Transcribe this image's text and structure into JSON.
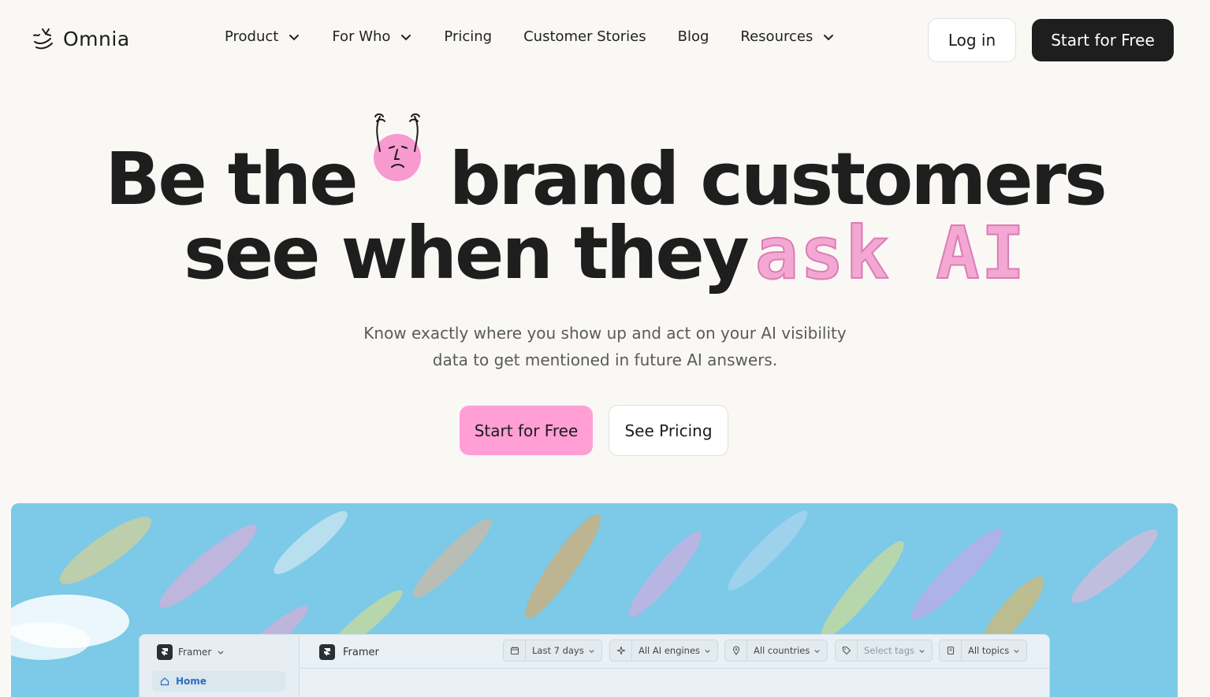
{
  "brand": {
    "name": "Omnia"
  },
  "nav": {
    "items": [
      {
        "label": "Product",
        "dropdown": true
      },
      {
        "label": "For Who",
        "dropdown": true
      },
      {
        "label": "Pricing",
        "dropdown": false
      },
      {
        "label": "Customer Stories",
        "dropdown": false
      },
      {
        "label": "Blog",
        "dropdown": false
      },
      {
        "label": "Resources",
        "dropdown": true
      }
    ],
    "login_label": "Log in",
    "start_label": "Start for Free"
  },
  "hero": {
    "line1_a": "Be the",
    "line1_b": "brand customers",
    "line2_a": "see when they",
    "line2_highlight": "ask AI",
    "subtitle_1": "Know exactly where you show up and act on your AI visibility",
    "subtitle_2": "data to get mentioned in future AI answers.",
    "cta_primary": "Start for Free",
    "cta_secondary": "See Pricing"
  },
  "dashboard": {
    "workspace": "Framer",
    "nav_home": "Home",
    "title": "Framer",
    "filters": [
      {
        "label": "Last 7 days",
        "icon": "calendar-icon",
        "muted": false
      },
      {
        "label": "All AI engines",
        "icon": "sparkle-icon",
        "muted": false
      },
      {
        "label": "All countries",
        "icon": "location-pin-icon",
        "muted": false
      },
      {
        "label": "Select tags",
        "icon": "tag-icon",
        "muted": true
      },
      {
        "label": "All topics",
        "icon": "document-icon",
        "muted": false
      }
    ]
  },
  "colors": {
    "background": "#faf8f5",
    "primary_dark": "#1e1e1e",
    "accent_pink": "#ff9fd5",
    "showcase_blue": "#7cc9e8"
  }
}
